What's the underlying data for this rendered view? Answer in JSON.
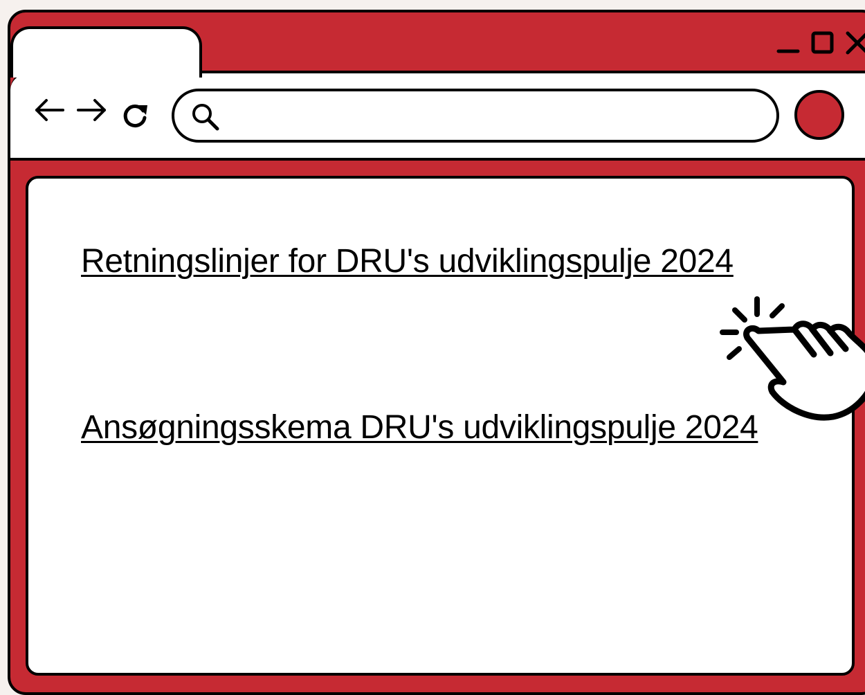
{
  "browser": {
    "controls": {
      "minimize": "minimize-icon",
      "maximize": "maximize-icon",
      "close": "close-icon"
    },
    "nav": {
      "back": "arrow-left-icon",
      "forward": "arrow-right-icon",
      "reload": "reload-icon"
    },
    "search": {
      "value": "",
      "placeholder": "",
      "icon": "search-icon"
    },
    "profile_color": "#c62a33"
  },
  "content": {
    "links": [
      {
        "label": "Retningslinjer for DRU's udviklingspulje 2024"
      },
      {
        "label": "Ansøgningsskema DRU's udviklingspulje 2024"
      }
    ]
  },
  "colors": {
    "accent": "#c62a33",
    "background": "#f6f1ee",
    "outline": "#000000"
  }
}
